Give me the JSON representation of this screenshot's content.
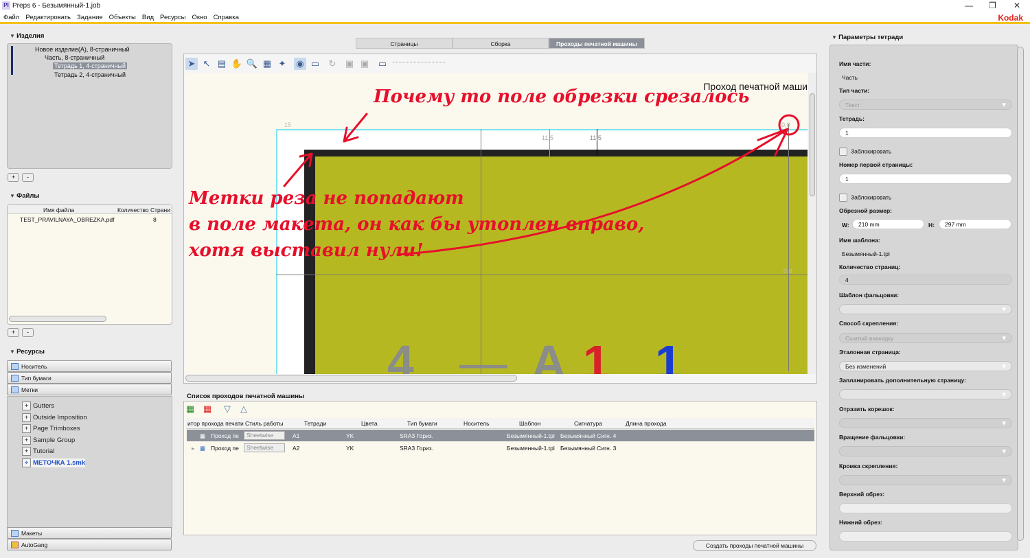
{
  "window": {
    "title": "Preps 6 - Безымянный-1.job",
    "logo": "PI",
    "brand": "Kodak"
  },
  "menu": [
    "Файл",
    "Редактировать",
    "Задание",
    "Объекты",
    "Вид",
    "Ресурсы",
    "Окно",
    "Справка"
  ],
  "products": {
    "header": "Изделия",
    "tree": [
      "Новое изделие(A), 8-страничный",
      "Часть, 8-страничный",
      "Тетрадь 1, 4-страничный",
      "Тетрадь 2, 4-страничный"
    ]
  },
  "files": {
    "header": "Файлы",
    "col_name": "Имя файла",
    "col_pages": "Количество Страни",
    "rows": [
      {
        "name": "TEST_PRAVILNAYA_OBREZKA.pdf",
        "pages": "8"
      }
    ]
  },
  "buttons": {
    "plus": "+",
    "minus": "-"
  },
  "resources": {
    "header": "Ресурсы",
    "sections": [
      "Носитель",
      "Тип бумаги",
      "Метки"
    ],
    "marks": [
      "Gutters",
      "Outside Imposition",
      "Page Trimboxes",
      "Sample Group",
      "Tutorial"
    ],
    "selected_mark": "МЕТОЧКА 1.smk",
    "bottom": [
      "Макеты",
      "AutoGang"
    ]
  },
  "tabs": [
    "Страницы",
    "Сборка",
    "Проходы печатной машины"
  ],
  "canvas": {
    "title": "Проход печатной маши",
    "dim_left": "15",
    "dim_a": "11,5",
    "dim_b": "11,5",
    "dim_right": "0,0",
    "dim_side": "0,0",
    "page_letters": [
      "4",
      "—",
      "A",
      "1",
      "1"
    ],
    "annotations": {
      "top": "Почему то поле обрезки срезалось",
      "line1": "Метки реза не попадают",
      "line2": "в поле макета, он как бы утоплен вправо,",
      "line3": "хотя выставил нули!"
    }
  },
  "runs": {
    "header": "Список проходов печатной машины",
    "columns": [
      "итор прохода печати",
      "Стиль работы",
      "Тетради",
      "Цвета",
      "Тип бумаги",
      "Носитель",
      "Шаблон",
      "Сигнатура",
      "Длина прохода"
    ],
    "rows": [
      {
        "name": "Проход пе",
        "style": "Sheetwise",
        "sig": "A1",
        "colors": "YK",
        "paper": "SRA3 Гориз.",
        "media": "",
        "template": "Безымянный-1.tpl",
        "signature": "Безымянный Сигн. 4",
        "length": ""
      },
      {
        "name": "Проход пе",
        "style": "Sheetwise",
        "sig": "A2",
        "colors": "YK",
        "paper": "SRA3 Гориз.",
        "media": "",
        "template": "Безымянный-1.tpl",
        "signature": "Безымянный Сигн. 3",
        "length": ""
      }
    ],
    "create_button": "Создать проходы печатной машины"
  },
  "params": {
    "header": "Параметры тетради",
    "part_name_label": "Имя части:",
    "part_name": "Часть",
    "part_type_label": "Тип части:",
    "part_type": "Текст",
    "signature_label": "Тетрадь:",
    "signature": "1",
    "lock": "Заблокировать",
    "first_page_label": "Номер первой страницы:",
    "first_page": "1",
    "trim_label": "Обрезной размер:",
    "w_label": "W:",
    "w": "210 mm",
    "h_label": "H:",
    "h": "297 mm",
    "template_label": "Имя шаблона:",
    "template": "Безымянный-1.tpl",
    "pages_label": "Количество страниц:",
    "pages": "4",
    "fold_label": "Шаблон фальцовки:",
    "binding_label": "Способ скрепления:",
    "binding": "Сшитый внакидку",
    "ref_page_label": "Эталонная страница:",
    "ref_page": "Без изменений",
    "extra_page_label": "Запланировать дополнительную страницу:",
    "spine_label": "Отразить корешок:",
    "rotation_label": "Вращение фальцовки:",
    "edge_label": "Кромка скрепления:",
    "top_trim_label": "Верхний обрез:",
    "bottom_trim_label": "Нижний обрез:"
  }
}
